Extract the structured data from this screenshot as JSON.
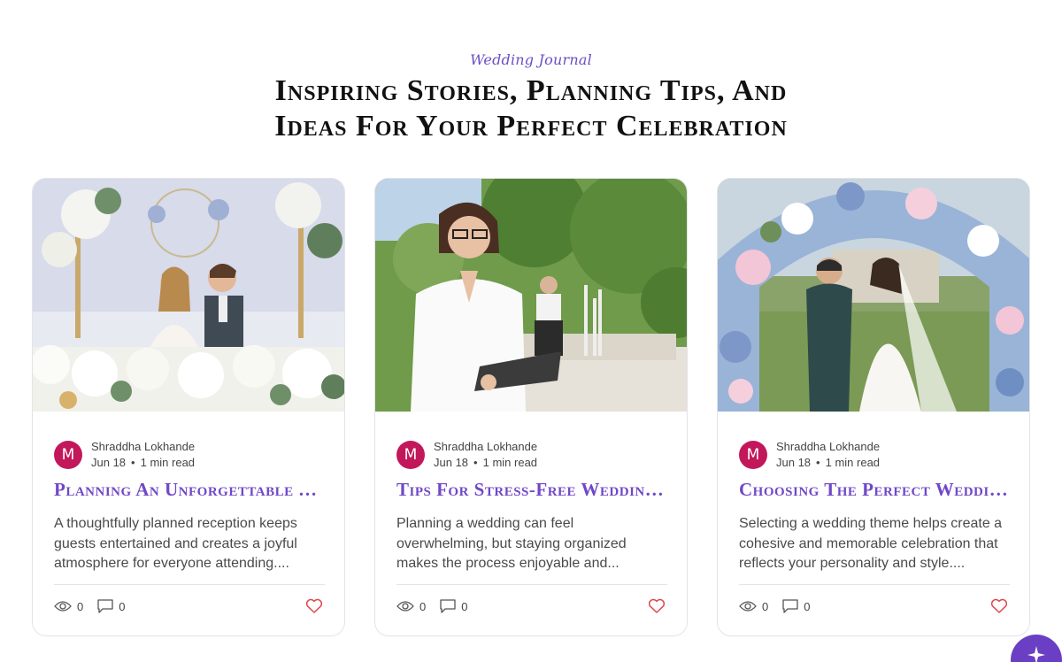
{
  "section": {
    "eyebrow": "Wedding Journal",
    "headline_line1": "Inspiring Stories, Planning Tips, And",
    "headline_line2": "Ideas For Your Perfect Celebration"
  },
  "cards": [
    {
      "author_initial": "M",
      "author": "Shraddha Lokhande",
      "date": "Jun 18",
      "read_time": "1 min read",
      "title": "Planning An Unforgettable Wedding Reception",
      "excerpt": "A thoughtfully planned reception keeps guests entertained and creates a joyful atmosphere for everyone attending....",
      "views": "0",
      "comments": "0",
      "image_desc": "couple-toasting-at-floral-head-table"
    },
    {
      "author_initial": "M",
      "author": "Shraddha Lokhande",
      "date": "Jun 18",
      "read_time": "1 min read",
      "title": "Tips For Stress-Free Wedding Planning",
      "excerpt": "Planning a wedding can feel overwhelming, but staying organized makes the process enjoyable and...",
      "views": "0",
      "comments": "0",
      "image_desc": "wedding-planner-with-tablet-outdoors"
    },
    {
      "author_initial": "M",
      "author": "Shraddha Lokhande",
      "date": "Jun 18",
      "read_time": "1 min read",
      "title": "Choosing The Perfect Wedding Theme",
      "excerpt": "Selecting a wedding theme helps create a cohesive and memorable celebration that reflects your personality and style....",
      "views": "0",
      "comments": "0",
      "image_desc": "couple-under-blue-floral-arch"
    }
  ],
  "colors": {
    "accent": "#7048c8",
    "avatar": "#c2185b",
    "heart": "#e0474c",
    "fab": "#6a3fc4"
  }
}
